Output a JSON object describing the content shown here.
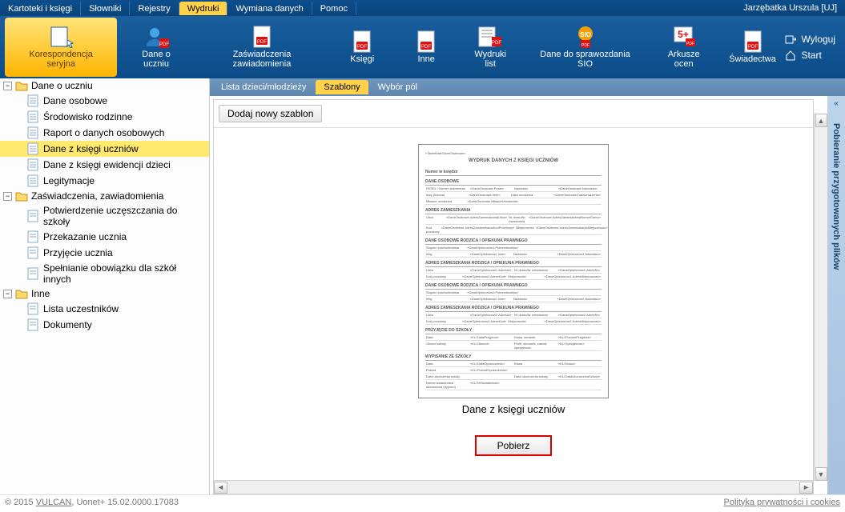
{
  "menu": {
    "tabs": [
      "Kartoteki i księgi",
      "Słowniki",
      "Rejestry",
      "Wydruki",
      "Wymiana danych",
      "Pomoc"
    ],
    "active_index": 3,
    "user": "Jarzębatka Urszula [UJ]"
  },
  "ribbon": {
    "items": [
      {
        "label": "Korespondencja seryjna",
        "icon": "doc-cursor"
      },
      {
        "label": "Dane o uczniu",
        "icon": "user-pdf"
      },
      {
        "label": "Zaświadczenia zawiadomienia",
        "icon": "pdf"
      },
      {
        "label": "Księgi",
        "icon": "pdf"
      },
      {
        "label": "Inne",
        "icon": "pdf"
      },
      {
        "label": "Wydruki list",
        "icon": "pdf-list"
      },
      {
        "label": "Dane do sprawozdania SIO",
        "icon": "sio"
      },
      {
        "label": "Arkusze ocen",
        "icon": "five-plus"
      },
      {
        "label": "Świadectwa",
        "icon": "pdf"
      }
    ],
    "active_index": 0,
    "right": {
      "logout": "Wyloguj",
      "start": "Start"
    }
  },
  "sidebar": {
    "groups": [
      {
        "label": "Dane o uczniu",
        "items": [
          "Dane osobowe",
          "Środowisko rodzinne",
          "Raport o danych osobowych",
          "Dane z księgi uczniów",
          "Dane z księgi ewidencji dzieci",
          "Legitymacje"
        ],
        "selected_index": 3
      },
      {
        "label": "Zaświadczenia, zawiadomienia",
        "items": [
          "Potwierdzenie uczęszczania do szkoły",
          "Przekazanie ucznia",
          "Przyjęcie ucznia",
          "Spełnianie obowiązku dla szkół innych"
        ]
      },
      {
        "label": "Inne",
        "items": [
          "Lista uczestników",
          "Dokumenty"
        ]
      }
    ]
  },
  "main": {
    "tabs": {
      "items": [
        "Lista dzieci/młodzieży",
        "Szablony",
        "Wybór pól"
      ],
      "active_index": 1
    },
    "toolbar": {
      "add_template": "Dodaj nowy szablon"
    },
    "preview": {
      "title": "WYDRUK DANYCH Z KSIĘGI UCZNIÓW",
      "caption": "Dane z księgi uczniów",
      "sections": [
        "Numer w księdze",
        "DANE OSOBOWE",
        "ADRES ZAMIESZKANIA",
        "DANE OSOBOWE RODZICA / OPIEKUNA PRAWNEGO",
        "ADRES ZAMIESZKANIA RODZICA / OPIEKUNA PRAWNEGO",
        "DANE OSOBOWE RODZICA / OPIEKUNA PRAWNEGO",
        "ADRES ZAMIESZKANIA RODZICA / OPIEKUNA PRAWNEGO",
        "PRZYJĘCIE DO SZKOŁY",
        "WYPISANIE ZE SZKOŁY"
      ]
    },
    "download_label": "Pobierz"
  },
  "vband": {
    "text": "Pobieranie przygotowanych plików"
  },
  "footer": {
    "left_prefix": "© 2015 ",
    "left_link": "VULCAN",
    "left_rest": ", Uonet+ 15.02.0000.17083",
    "right": "Polityka prywatności i cookies"
  },
  "colors": {
    "accent": "#0b4c88",
    "highlight": "#ffd24a"
  }
}
